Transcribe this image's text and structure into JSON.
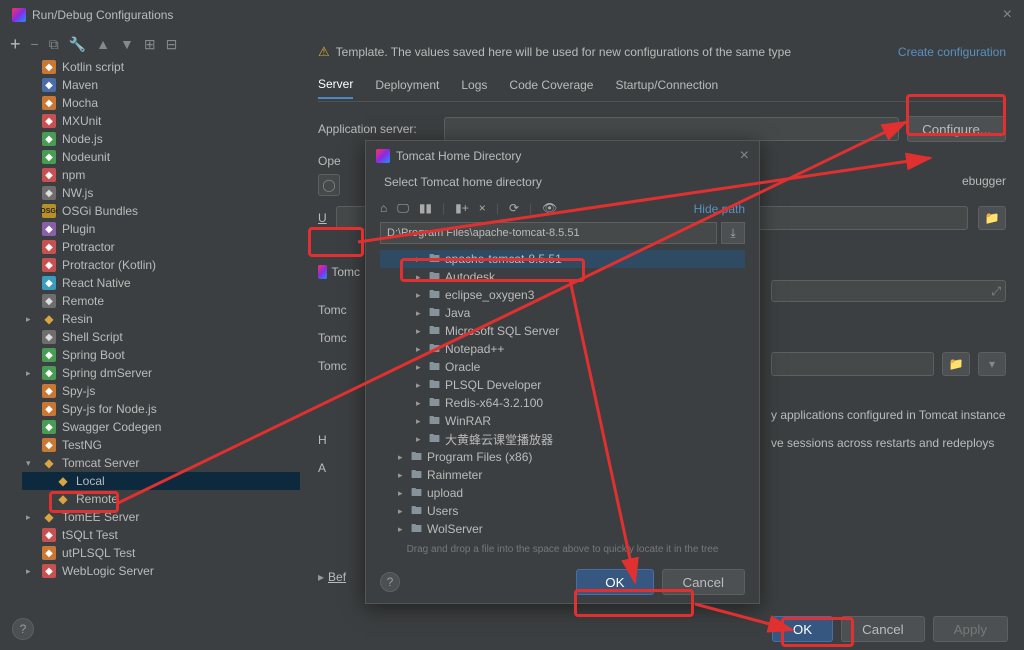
{
  "window": {
    "title": "Run/Debug Configurations"
  },
  "template_msg": "Template. The values saved here will be used for new configurations of the same type",
  "create_link": "Create configuration",
  "tabs": [
    "Server",
    "Deployment",
    "Logs",
    "Code Coverage",
    "Startup/Connection"
  ],
  "app_server_label": "Application server:",
  "configure_btn": "Configure...",
  "open_label": "Ope",
  "debugger_label": "ebugger",
  "u_label": "U",
  "tomcat_labels": [
    "Tomc",
    "Tomc",
    "Tomc",
    "Tomc",
    "H",
    "A"
  ],
  "deploy_hint": "y applications configured in Tomcat instance",
  "preserve_hint": "ve sessions across restarts and redeploys",
  "before_launch": "Before launch",
  "btn_ok": "OK",
  "btn_cancel": "Cancel",
  "btn_apply": "Apply",
  "tree": [
    {
      "label": "Kotlin script",
      "ic": "ic-orange"
    },
    {
      "label": "Maven",
      "ic": "ic-blue"
    },
    {
      "label": "Mocha",
      "ic": "ic-orange"
    },
    {
      "label": "MXUnit",
      "ic": "ic-red"
    },
    {
      "label": "Node.js",
      "ic": "ic-green"
    },
    {
      "label": "Nodeunit",
      "ic": "ic-green"
    },
    {
      "label": "npm",
      "ic": "ic-red"
    },
    {
      "label": "NW.js",
      "ic": "ic-grey"
    },
    {
      "label": "OSGi Bundles",
      "ic": "ic-osgi",
      "txt": "OSGi"
    },
    {
      "label": "Plugin",
      "ic": "ic-purple"
    },
    {
      "label": "Protractor",
      "ic": "ic-red"
    },
    {
      "label": "Protractor (Kotlin)",
      "ic": "ic-red"
    },
    {
      "label": "React Native",
      "ic": "ic-cyan"
    },
    {
      "label": "Remote",
      "ic": "ic-grey"
    },
    {
      "label": "Resin",
      "ic": "ic-yellow",
      "arrow": true
    },
    {
      "label": "Shell Script",
      "ic": "ic-grey"
    },
    {
      "label": "Spring Boot",
      "ic": "ic-green"
    },
    {
      "label": "Spring dmServer",
      "ic": "ic-green",
      "arrow": true
    },
    {
      "label": "Spy-js",
      "ic": "ic-orange"
    },
    {
      "label": "Spy-js for Node.js",
      "ic": "ic-orange"
    },
    {
      "label": "Swagger Codegen",
      "ic": "ic-green"
    },
    {
      "label": "TestNG",
      "ic": "ic-orange"
    },
    {
      "label": "Tomcat Server",
      "ic": "ic-yellow",
      "arrow": true,
      "open": true
    },
    {
      "label": "Local",
      "ic": "ic-yellow",
      "indent": 2,
      "sel": true
    },
    {
      "label": "Remote",
      "ic": "ic-yellow",
      "indent": 2
    },
    {
      "label": "TomEE Server",
      "ic": "ic-yellow",
      "arrow": true
    },
    {
      "label": "tSQLt Test",
      "ic": "ic-red"
    },
    {
      "label": "utPLSQL Test",
      "ic": "ic-orange"
    },
    {
      "label": "WebLogic Server",
      "ic": "ic-red",
      "arrow": true
    }
  ],
  "dialog": {
    "title": "Tomcat Home Directory",
    "sub": "Select Tomcat home directory",
    "hide_path": "Hide path",
    "path": "D:\\Program Files\\apache-tomcat-8.5.51",
    "drag_hint": "Drag and drop a file into the space above to quickly locate it in the tree",
    "ok": "OK",
    "cancel": "Cancel",
    "folders": [
      {
        "name": "apache-tomcat-8.5.51",
        "sel": true,
        "indent": 2
      },
      {
        "name": "Autodesk",
        "indent": 2
      },
      {
        "name": "eclipse_oxygen3",
        "indent": 2
      },
      {
        "name": "Java",
        "indent": 2
      },
      {
        "name": "Microsoft SQL Server",
        "indent": 2
      },
      {
        "name": "Notepad++",
        "indent": 2
      },
      {
        "name": "Oracle",
        "indent": 2
      },
      {
        "name": "PLSQL Developer",
        "indent": 2
      },
      {
        "name": "Redis-x64-3.2.100",
        "indent": 2
      },
      {
        "name": "WinRAR",
        "indent": 2
      },
      {
        "name": "大黄蜂云课堂播放器",
        "indent": 2
      },
      {
        "name": "Program Files (x86)",
        "indent": 1
      },
      {
        "name": "Rainmeter",
        "indent": 1
      },
      {
        "name": "upload",
        "indent": 1
      },
      {
        "name": "Users",
        "indent": 1
      },
      {
        "name": "WolServer",
        "indent": 1
      }
    ]
  }
}
